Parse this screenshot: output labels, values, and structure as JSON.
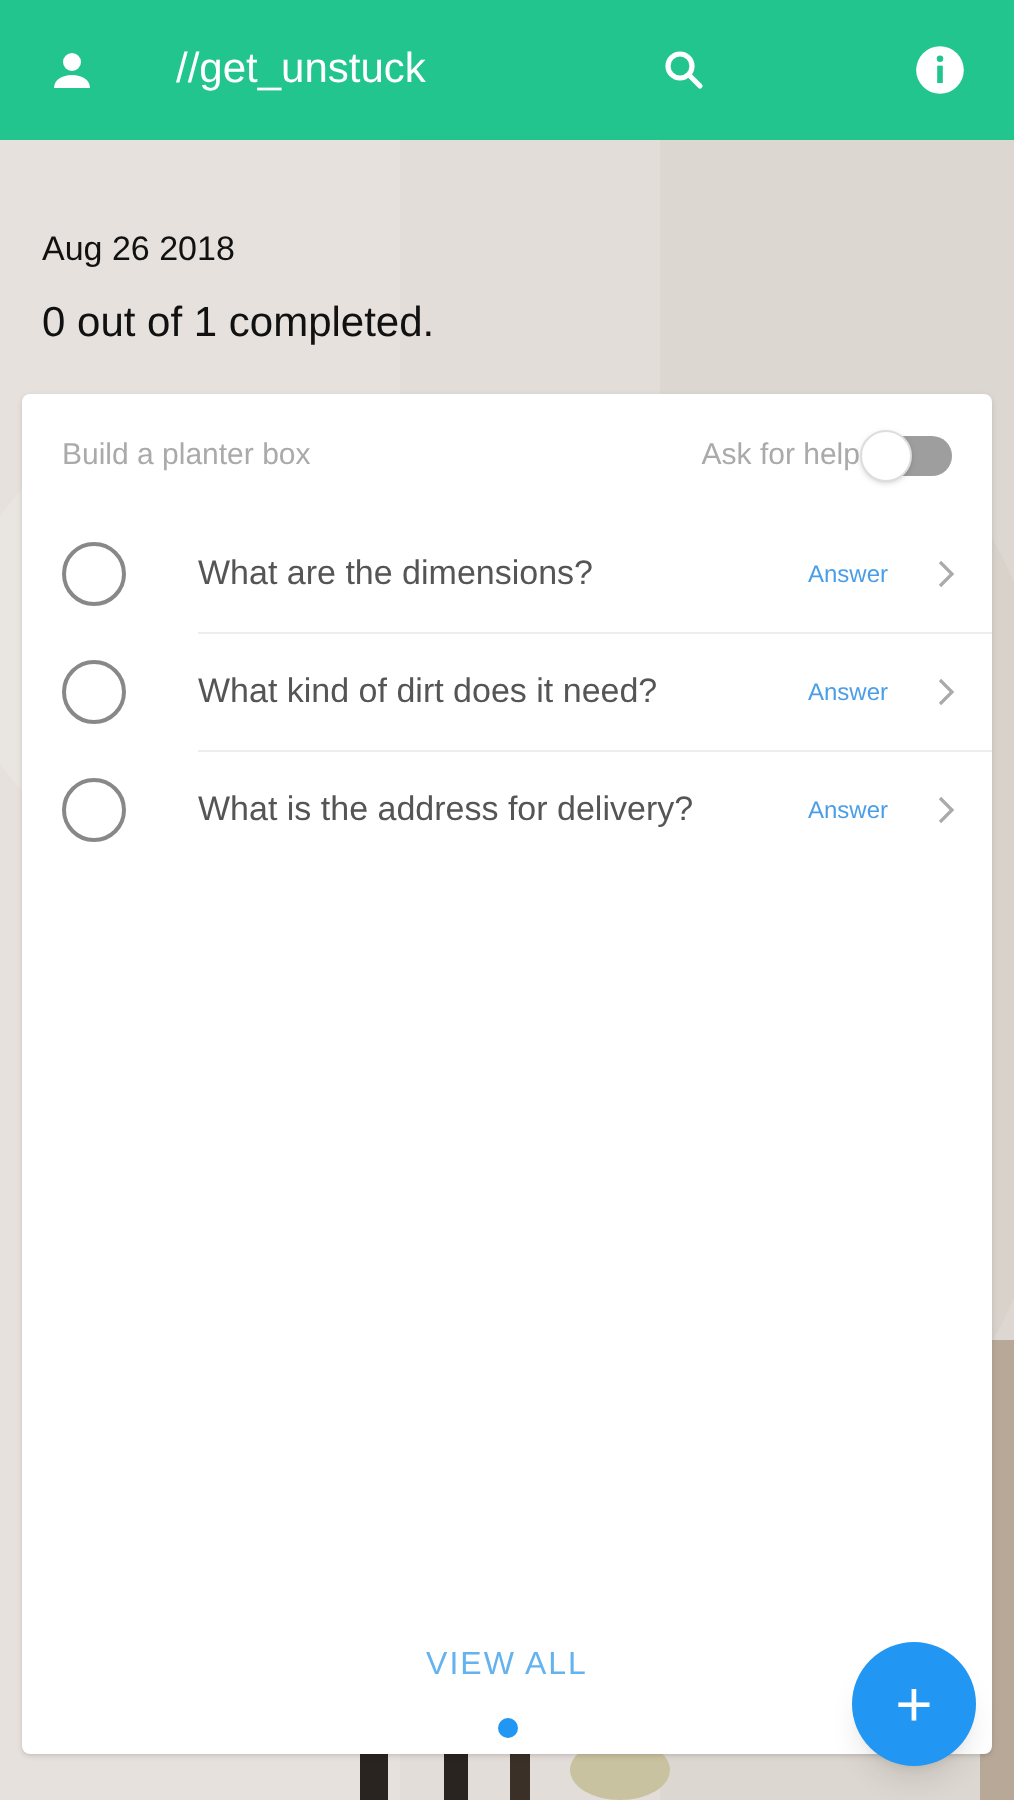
{
  "header": {
    "title": "//get_unstuck"
  },
  "summary": {
    "date": "Aug 26 2018",
    "progress": "0 out of 1 completed."
  },
  "card": {
    "goal": "Build a planter box",
    "help_toggle": {
      "label": "Ask for help",
      "on": false
    },
    "questions": [
      {
        "text": "What are the dimensions?",
        "action": "Answer",
        "checked": false
      },
      {
        "text": "What kind of dirt does it need?",
        "action": "Answer",
        "checked": false
      },
      {
        "text": "What is the address for delivery?",
        "action": "Answer",
        "checked": false
      }
    ],
    "view_all": "VIEW ALL",
    "pages": [
      {
        "selected": true
      }
    ]
  },
  "fab": {
    "label": "+"
  }
}
